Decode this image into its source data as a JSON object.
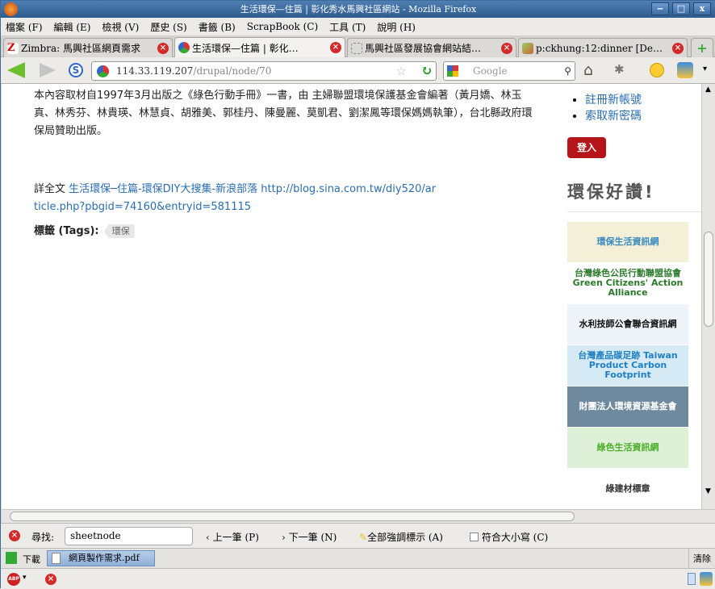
{
  "window": {
    "title": "生活環保—住篇 | 彰化秀水馬興社區網站 - Mozilla Firefox",
    "minimize": "‒",
    "maximize": "□",
    "close": "x"
  },
  "menu": [
    "檔案 (F)",
    "編輯 (E)",
    "檢視 (V)",
    "歷史 (S)",
    "書籤 (B)",
    "ScrapBook (C)",
    "工具 (T)",
    "說明 (H)"
  ],
  "tabs": [
    {
      "label": "Zimbra: 馬興社區網頁需求",
      "active": false
    },
    {
      "label": "生活環保—住篇 | 彰化…",
      "active": true
    },
    {
      "label": "馬興社區發展協會網站結…",
      "active": false
    },
    {
      "label": "p:ckhung:12:dinner [De…",
      "active": false
    }
  ],
  "new_tab": "+",
  "nav": {
    "url_host": "114.33.119.207",
    "url_path": "/drupal/node/70",
    "search_placeholder": "Google"
  },
  "article": {
    "para1": "本內容取材自1997年3月出版之《綠色行動手冊》一書，由 主婦聯盟環境保護基金會編著（黃月嬌、林玉真、林秀芬、林貴瑛、林慧貞、胡雅美、郭桂丹、陳曼麗、莫凱君、劉潔鳳等環保媽媽執筆），台北縣政府環保局贊助出版。",
    "more_prefix": "詳全文 ",
    "more_link": "生活環保─住篇-環保DIY大搜集-新浪部落",
    "more_url": "http://blog.sina.com.tw/diy520/article.php?pbgid=74160&entryid=581115",
    "tags_label": "標籤 (Tags):",
    "tags": [
      "環保"
    ]
  },
  "sidebar": {
    "links": [
      "註冊新帳號",
      "索取新密碼"
    ],
    "login_button": "登入",
    "heading": "環保好讚!",
    "banners": [
      {
        "text": "環保生活資訊網",
        "bg": "#f4f0d8",
        "fg": "#3a8ac0"
      },
      {
        "text": "台灣綠色公民行動聯盟協會 Green Citizens' Action Alliance",
        "bg": "#ffffff",
        "fg": "#2b7a2b"
      },
      {
        "text": "水利技師公會聯合資訊網",
        "bg": "#eef3fa",
        "fg": "#111111"
      },
      {
        "text": "台灣產品碳足跡 Taiwan Product Carbon Footprint",
        "bg": "#d6eaf5",
        "fg": "#1f7fc4"
      },
      {
        "text": "財團法人環境資源基金會",
        "bg": "#6f8a9e",
        "fg": "#ffffff"
      },
      {
        "text": "綠色生活資訊網",
        "bg": "#dff0d8",
        "fg": "#4caf2a"
      },
      {
        "text": "綠建材標章",
        "bg": "#ffffff",
        "fg": "#333333"
      }
    ]
  },
  "findbar": {
    "label": "尋找:",
    "value": "sheetnode",
    "prev": "上一筆 (P)",
    "next": "下一筆 (N)",
    "highlight": "全部強調標示 (A)",
    "match_case": "符合大小寫 (C)"
  },
  "downloads": {
    "label": "下載",
    "file": "網頁製作需求.pdf",
    "clear": "清除"
  },
  "status": {
    "abp": "ABP"
  }
}
